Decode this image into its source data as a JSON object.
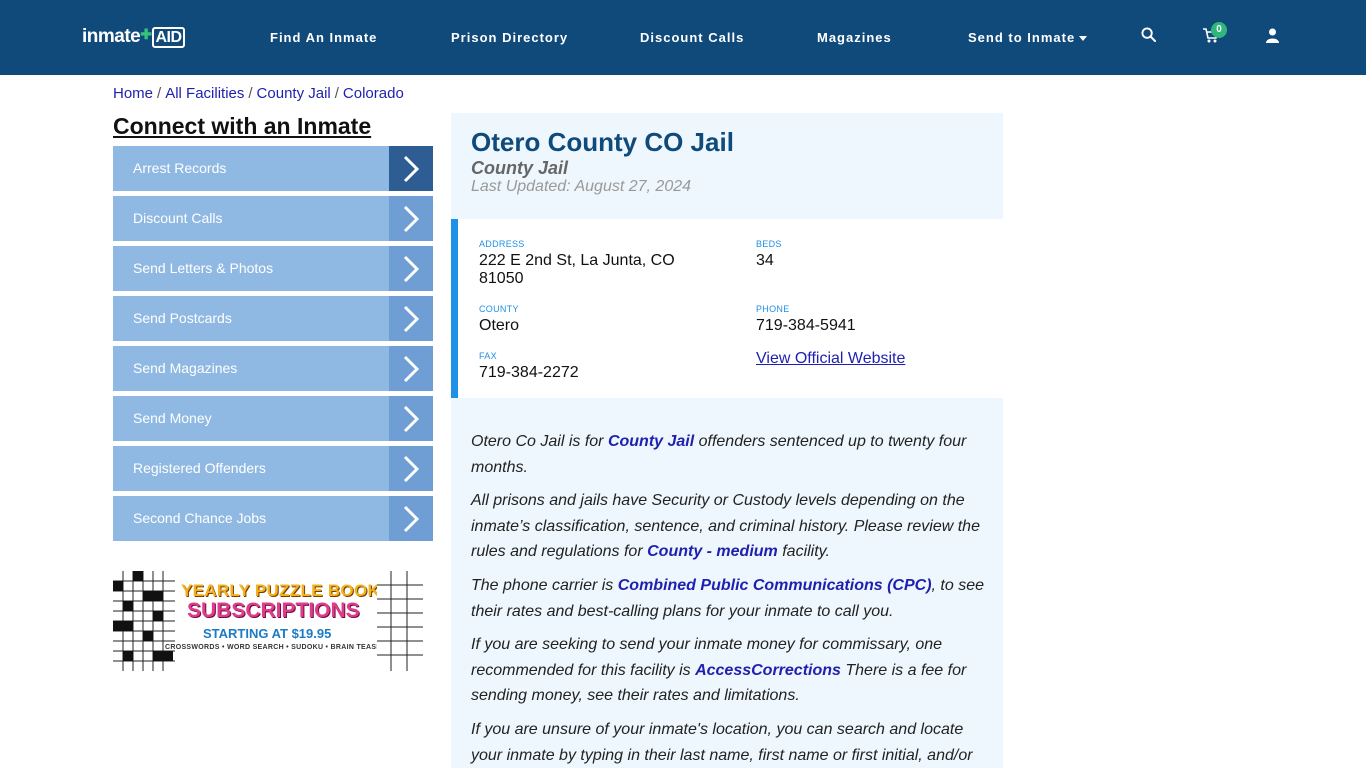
{
  "nav": {
    "logo_main": "inmate",
    "logo_aid": "AID",
    "links": [
      "Find An Inmate",
      "Prison Directory",
      "Discount Calls",
      "Magazines",
      "Send to Inmate"
    ],
    "cart_count": "0"
  },
  "breadcrumb": [
    "Home",
    "All Facilities",
    "County Jail",
    "Colorado"
  ],
  "sidebar": {
    "title": "Connect with an Inmate",
    "items": [
      "Arrest Records",
      "Discount Calls",
      "Send Letters & Photos",
      "Send Postcards",
      "Send Magazines",
      "Send Money",
      "Registered Offenders",
      "Second Chance Jobs"
    ]
  },
  "promo": {
    "line1": "YEARLY PUZZLE BOOK",
    "line2": "SUBSCRIPTIONS",
    "line3": "STARTING AT $19.95",
    "line4": "CROSSWORDS • WORD SEARCH • SUDOKU • BRAIN TEASERS"
  },
  "facility": {
    "title": "Otero County CO Jail",
    "type": "County Jail",
    "updated": "Last Updated: August 27, 2024",
    "address_label": "ADDRESS",
    "address_line1": "222 E 2nd St, La Junta, CO",
    "address_line2": "81050",
    "beds_label": "BEDS",
    "beds": "34",
    "county_label": "COUNTY",
    "county": "Otero",
    "phone_label": "PHONE",
    "phone": "719-384-5941",
    "fax_label": "FAX",
    "fax": "719-384-2272",
    "website_link": "View Official Website"
  },
  "body": {
    "p1_a": "Otero Co Jail is for ",
    "p1_link": "County Jail",
    "p1_b": " offenders sentenced up to twenty four months.",
    "p2_a": "All prisons and jails have Security or Custody levels depending on the inmate’s classification, sentence, and criminal history. Please review the rules and regulations for ",
    "p2_link": "County - medium",
    "p2_b": " facility.",
    "p3_a": "The phone carrier is ",
    "p3_link": "Combined Public Communications (CPC)",
    "p3_b": ", to see their rates and best-calling plans for your inmate to call you.",
    "p4_a": "If you are seeking to send your inmate money for commissary, one recommended for this facility is ",
    "p4_link": "AccessCorrections",
    "p4_b": " There is a fee for sending money, see their rates and limitations.",
    "p5": "If you are unsure of your inmate's location, you can search and locate your inmate by typing in their last name, first name or first initial, and/or"
  }
}
